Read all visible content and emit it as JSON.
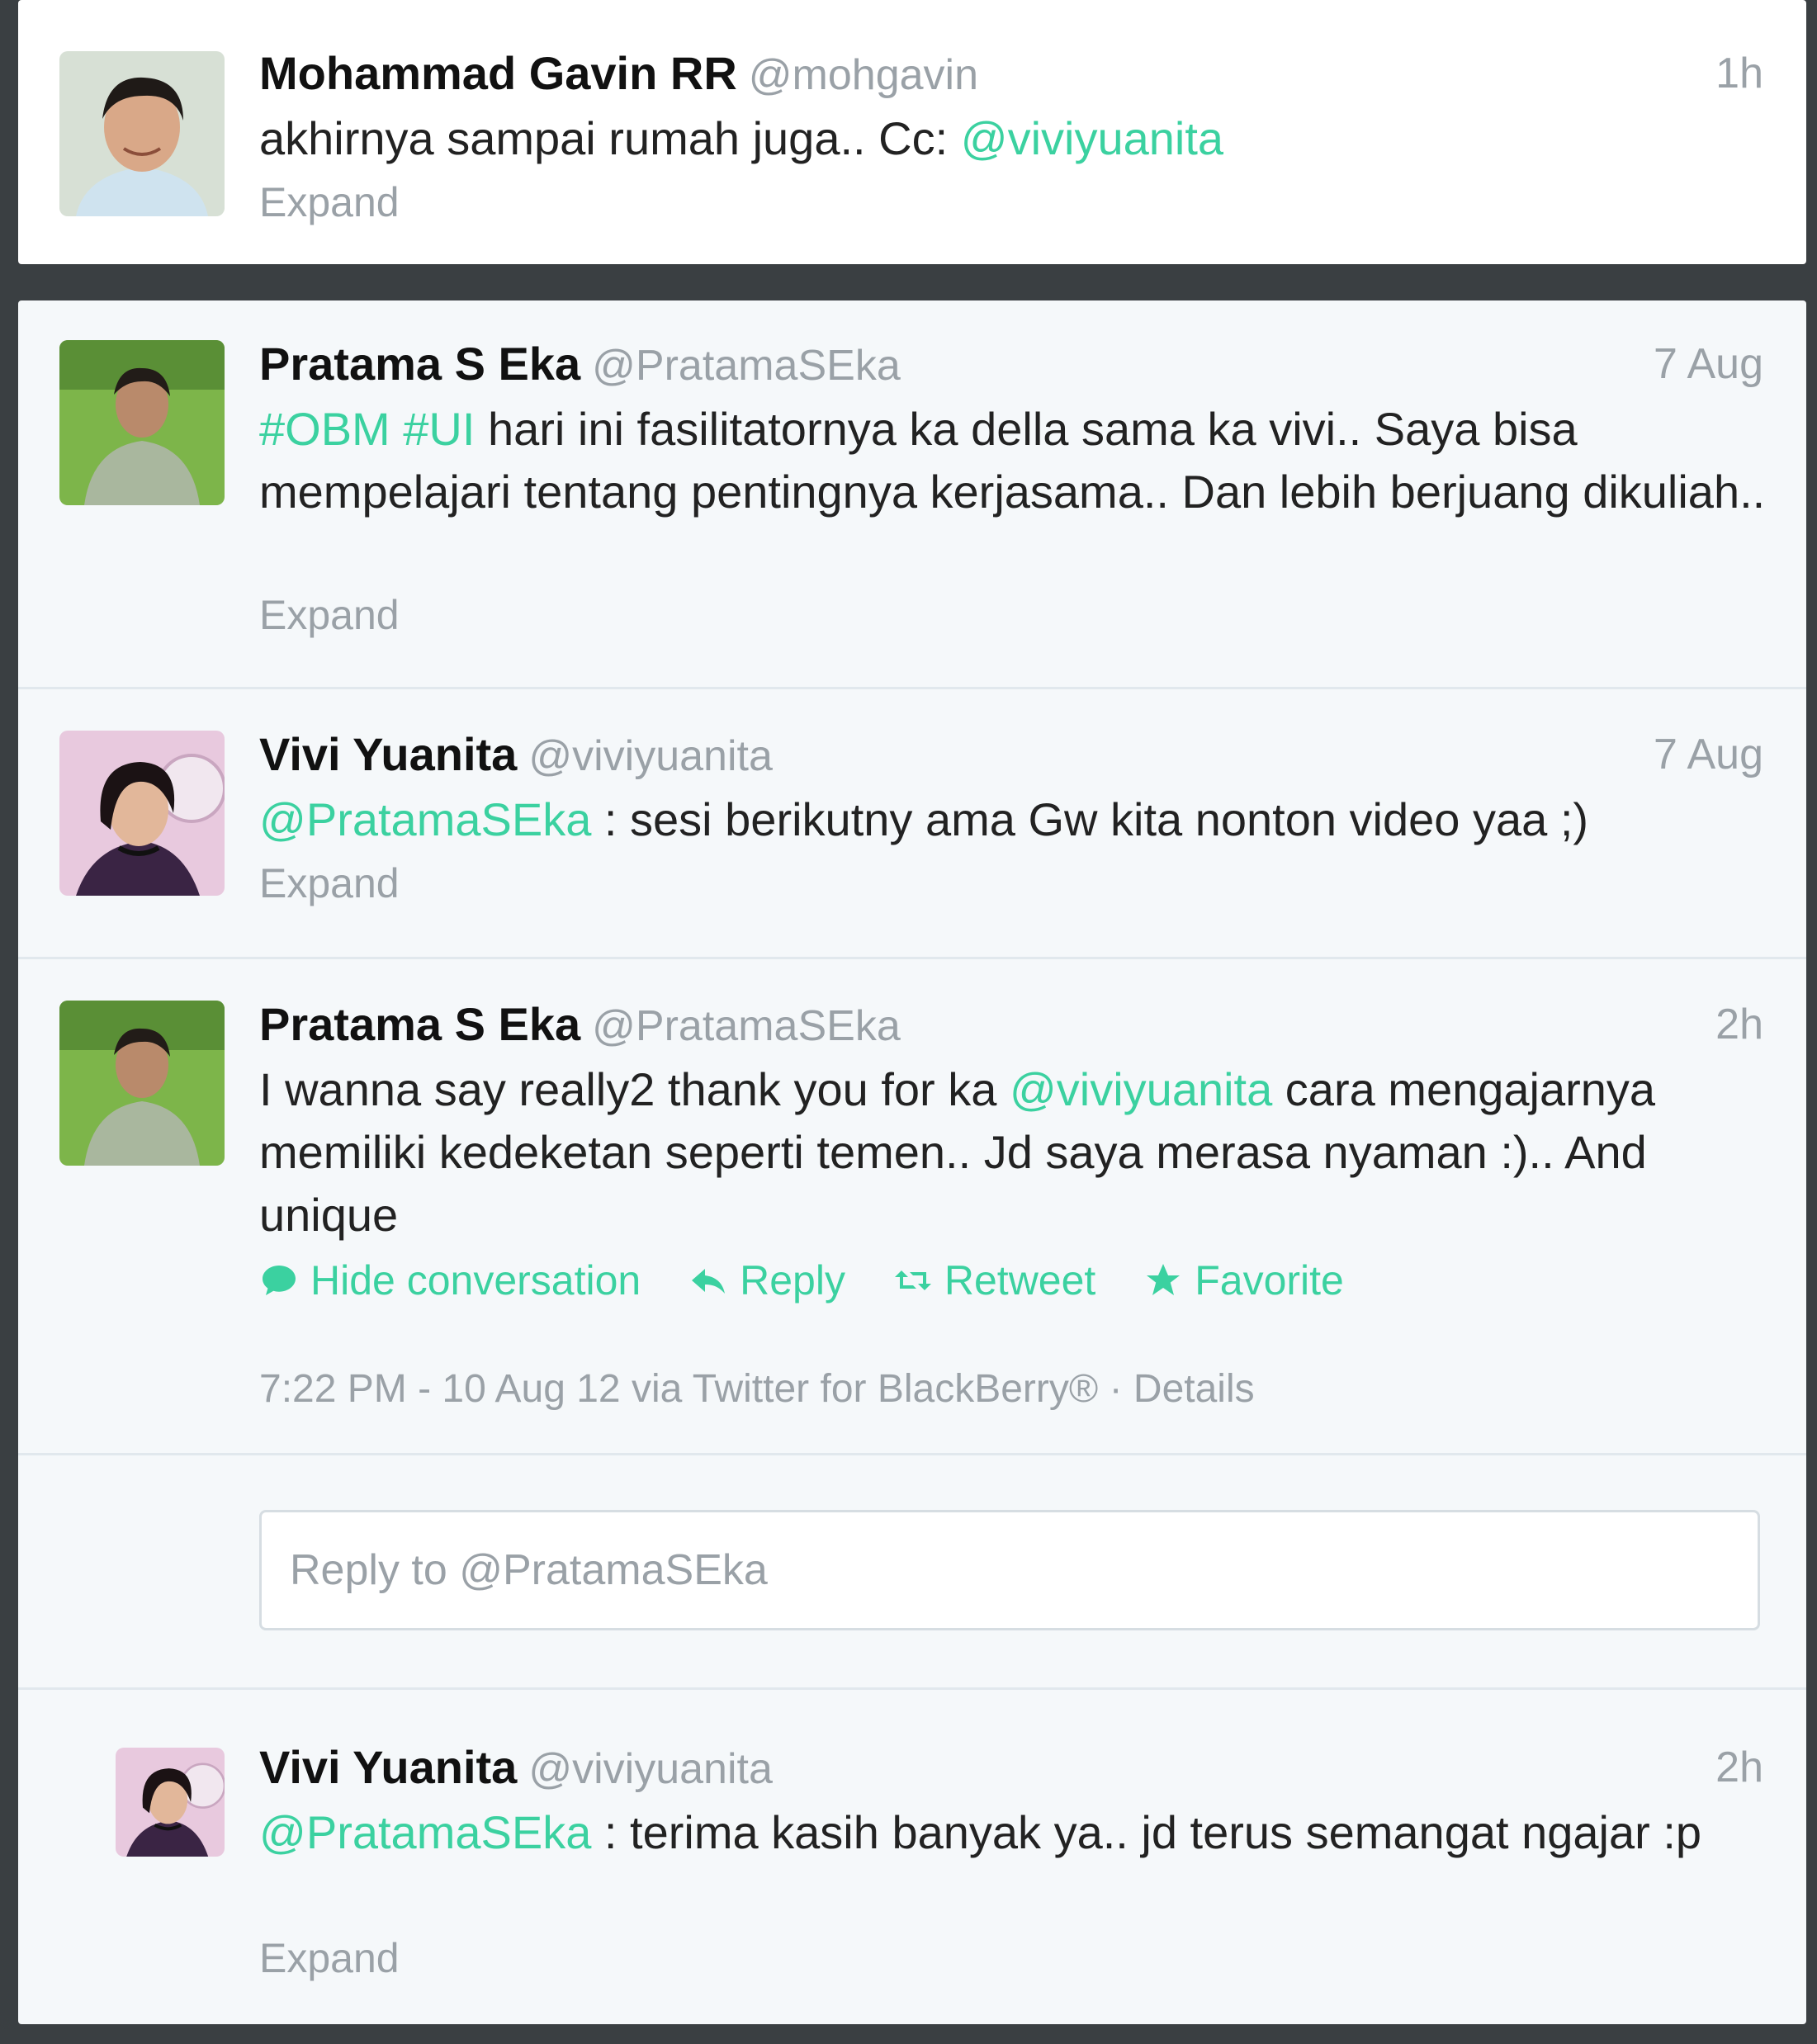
{
  "accent_color": "#3bd1a0",
  "tweets": [
    {
      "name": "Mohammad Gavin RR",
      "handle": "@mohgavin",
      "time": "1h",
      "text": "akhirnya sampai rumah juga.. Cc: ",
      "mention": "@viviyuanita",
      "expand": "Expand"
    },
    {
      "name": "Pratama S Eka",
      "handle": "@PratamaSEka",
      "time": "7 Aug",
      "hashtag1": "#OBM",
      "hashtag2": "#UI",
      "text": " hari ini fasilitatornya ka della sama ka vivi.. Saya bisa mempelajari tentang pentingnya kerjasama.. Dan lebih berjuang dikuliah..",
      "expand": "Expand"
    },
    {
      "name": "Vivi Yuanita",
      "handle": "@viviyuanita",
      "time": "7 Aug",
      "mention": "@PratamaSEka",
      "text": " : sesi berikutny ama Gw kita nonton video yaa ;)",
      "expand": "Expand"
    },
    {
      "name": "Pratama S Eka",
      "handle": "@PratamaSEka",
      "time": "2h",
      "text_before": "I wanna say really2 thank you for ka ",
      "mention": "@viviyuanita",
      "text_after": " cara mengajarnya memiliki kedeketan seperti temen.. Jd saya merasa nyaman :).. And unique",
      "actions": {
        "hide": "Hide conversation",
        "reply": "Reply",
        "retweet": "Retweet",
        "favorite": "Favorite"
      },
      "meta": "7:22 PM - 10 Aug 12 via Twitter for BlackBerry® · Details",
      "reply_placeholder": "Reply to @PratamaSEka"
    },
    {
      "name": "Vivi Yuanita",
      "handle": "@viviyuanita",
      "time": "2h",
      "mention": "@PratamaSEka",
      "text": " : terima kasih banyak ya.. jd terus semangat ngajar :p",
      "expand": "Expand"
    }
  ],
  "icons": {
    "hide": "speech-bubble-icon",
    "reply": "reply-arrow-icon",
    "retweet": "retweet-icon",
    "favorite": "star-icon"
  }
}
